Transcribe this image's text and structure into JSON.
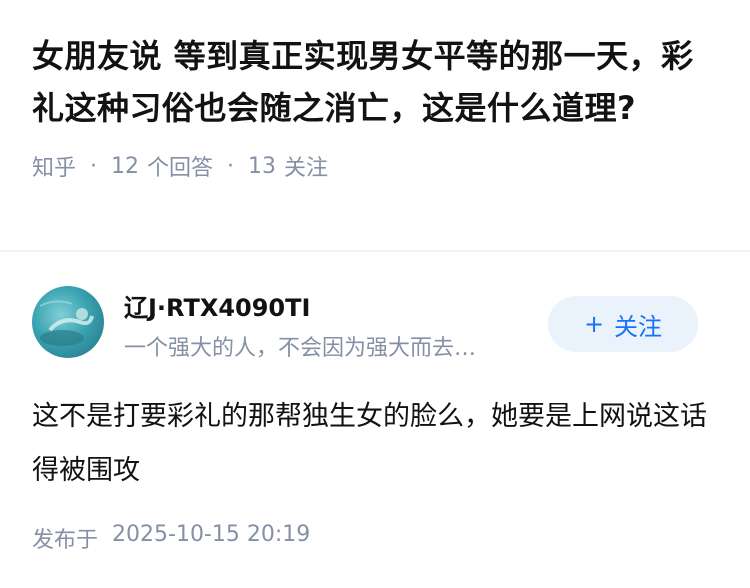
{
  "question": {
    "title": "女朋友说 等到真正实现男女平等的那一天，彩礼这种习俗也会随之消亡，这是什么道理?",
    "source": "知乎",
    "separator": "·",
    "answer_count": "12",
    "answer_label": "个回答",
    "follow_count": "13",
    "follow_label": "关注"
  },
  "answer": {
    "author": {
      "name": "辽J·RTX4090TI",
      "bio": "一个强大的人，不会因为强大而去…",
      "avatar_icon": "avatar-image"
    },
    "follow_button": {
      "icon": "+",
      "label": "关注"
    },
    "content": "这不是打要彩礼的那帮独生女的脸么，她要是上网说这话得被围攻",
    "publish_label": "发布于",
    "publish_time": "2025-10-15 20:19"
  },
  "colors": {
    "text_primary": "#121212",
    "text_secondary": "#8590a6",
    "accent": "#1772f6",
    "button_bg": "#eaf2fb",
    "divider": "#f0f1f3"
  }
}
